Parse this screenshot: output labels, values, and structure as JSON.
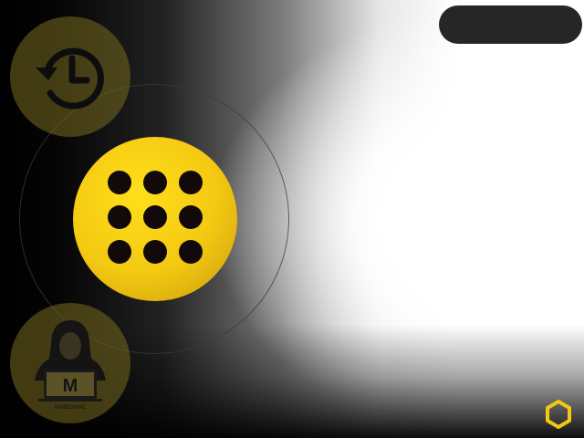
{
  "status_pill": {
    "label": ""
  },
  "buttons": {
    "history": {
      "icon": "history-icon"
    },
    "apps": {
      "icon": "app-grid-icon",
      "dot_count": 9
    },
    "profile": {
      "icon": "anbernic-hacker-avatar-icon",
      "brand": "ANBERNIC",
      "letter": "M"
    }
  },
  "corner": {
    "icon": "hexagon-icon"
  },
  "colors": {
    "accent": "#f3c812",
    "dim_accent": "#786a1e",
    "pill": "#262626",
    "dots": "#120a0a"
  }
}
